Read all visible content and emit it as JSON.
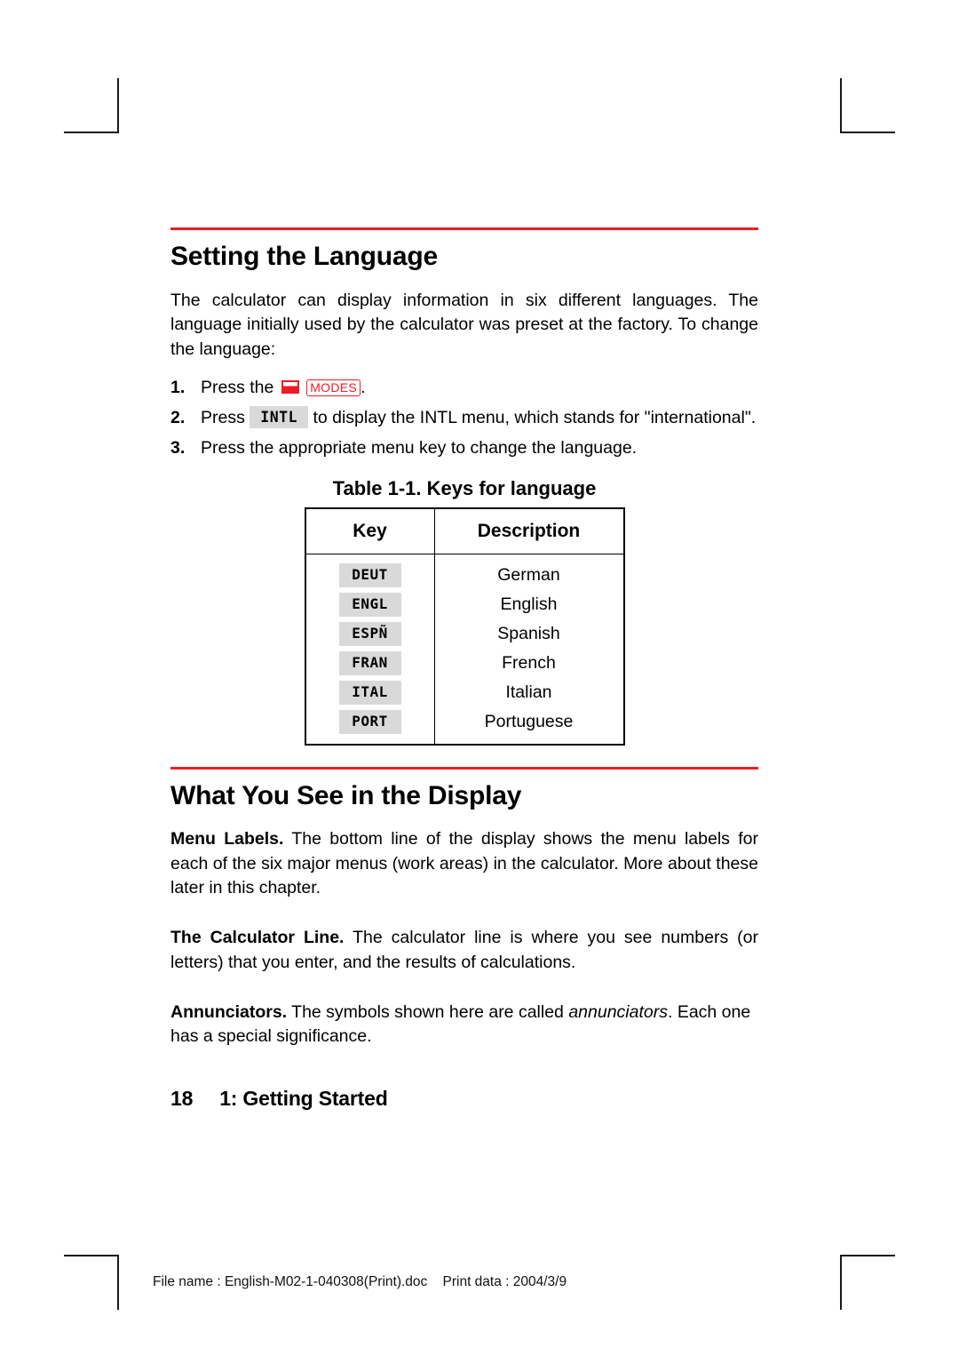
{
  "colors": {
    "accent_red": "#ee1c25",
    "key_gray": "#d9d9d9",
    "text_black": "#000000"
  },
  "sections": {
    "language": {
      "title": "Setting the Language",
      "intro": "The calculator can display information in six different languages. The language initially used by the calculator was preset at the factory. To change the language:",
      "steps": [
        {
          "num": "1.",
          "before": "Press the",
          "shift_icon": "red-shift-key-icon",
          "key_label": "MODES",
          "after": "."
        },
        {
          "num": "2.",
          "before": "Press",
          "key_label": "INTL",
          "after": "to display the INTL menu, which stands for \"international\"."
        },
        {
          "num": "3.",
          "text": "Press the appropriate menu key to change the language."
        }
      ]
    },
    "table": {
      "caption": "Table 1-1. Keys for language",
      "headers": [
        "Key",
        "Description"
      ],
      "rows": [
        {
          "key": "DEUT",
          "description": "German"
        },
        {
          "key": "ENGL",
          "description": "English"
        },
        {
          "key": "ESPÑ",
          "description": "Spanish"
        },
        {
          "key": "FRAN",
          "description": "French"
        },
        {
          "key": "ITAL",
          "description": "Italian"
        },
        {
          "key": "PORT",
          "description": "Portuguese"
        }
      ]
    },
    "display": {
      "title": "What You See in the Display",
      "paragraphs": [
        {
          "lead": "Menu Labels.",
          "text": " The bottom line of the display shows the menu labels for each of the six major menus (work areas) in the calculator. More about these later in this chapter."
        },
        {
          "lead": "The Calculator Line.",
          "text": " The calculator line is where you see numbers (or letters) that you enter, and the results of calculations."
        },
        {
          "lead": "Annunciators.",
          "text_before": " The symbols shown here are called ",
          "emphasis": "annunciators",
          "text_after": ". Each one has a special significance."
        }
      ]
    }
  },
  "page_footer": {
    "page_number": "18",
    "chapter": "1: Getting Started"
  },
  "print_footer": {
    "text": "File name : English-M02-1-040308(Print).doc    Print data : 2004/3/9"
  }
}
